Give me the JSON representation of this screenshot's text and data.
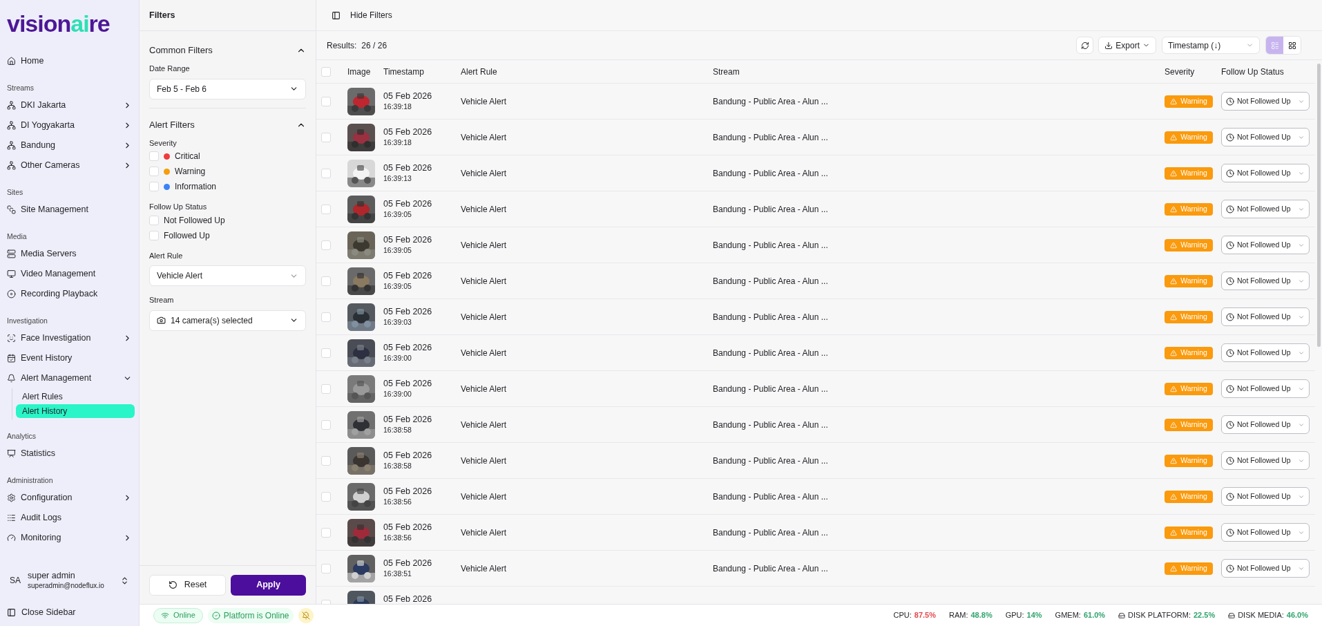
{
  "logo": {
    "parts": [
      "vision",
      "ai",
      "re"
    ]
  },
  "sidebar": {
    "sections": [
      {
        "items": [
          {
            "label": "Home",
            "selected": false
          }
        ]
      },
      {
        "title": "Streams",
        "items": [
          {
            "label": "DKI Jakarta",
            "selected": false,
            "expanded": false
          },
          {
            "label": "DI Yogyakarta",
            "selected": false,
            "expanded": false
          },
          {
            "label": "Bandung",
            "selected": false,
            "expanded": false
          },
          {
            "label": "Other Cameras",
            "selected": false,
            "expanded": false
          }
        ]
      },
      {
        "title": "Sites",
        "items": [
          {
            "label": "Site Management",
            "selected": false
          }
        ]
      },
      {
        "title": "Media",
        "items": [
          {
            "label": "Media Servers",
            "selected": false
          },
          {
            "label": "Video Management",
            "selected": false
          },
          {
            "label": "Recording Playback",
            "selected": false
          }
        ]
      },
      {
        "title": "Investigation",
        "items": [
          {
            "label": "Face Investigation",
            "selected": false,
            "expanded": false
          },
          {
            "label": "Event History",
            "selected": false
          },
          {
            "label": "Alert Management",
            "selected": false,
            "expanded": true,
            "children": [
              {
                "label": "Alert Rules",
                "selected": false
              },
              {
                "label": "Alert History",
                "selected": true
              }
            ]
          }
        ]
      },
      {
        "title": "Analytics",
        "items": [
          {
            "label": "Statistics",
            "selected": false
          }
        ]
      },
      {
        "title": "Administration",
        "items": [
          {
            "label": "Configuration",
            "selected": false,
            "expanded": false
          },
          {
            "label": "Audit Logs",
            "selected": false
          },
          {
            "label": "Monitoring",
            "selected": false,
            "expanded": false
          }
        ]
      }
    ],
    "user": {
      "initials": "SA",
      "name": "super admin",
      "email": "superadmin@nodeflux.io"
    },
    "close_label": "Close Sidebar"
  },
  "filters": {
    "title": "Filters",
    "common": {
      "title": "Common Filters",
      "expanded": true,
      "date_label": "Date Range",
      "date_value": "Feb 5 - Feb 6"
    },
    "alert": {
      "title": "Alert Filters",
      "expanded": true,
      "severity_label": "Severity",
      "severities": [
        {
          "label": "Critical",
          "checked": false,
          "color": "#ef3b3b"
        },
        {
          "label": "Warning",
          "checked": false,
          "color": "#f59e0b"
        },
        {
          "label": "Information",
          "checked": false,
          "color": "#3b82f6"
        }
      ],
      "follow_label": "Follow Up Status",
      "follow": [
        {
          "label": "Not Followed Up",
          "checked": false
        },
        {
          "label": "Followed Up",
          "checked": false
        }
      ],
      "rule_label": "Alert Rule",
      "rule_value": "Vehicle Alert",
      "stream_label": "Stream",
      "stream_value": "14 camera(s) selected"
    },
    "reset": "Reset",
    "apply": "Apply"
  },
  "main": {
    "hide_filters": "Hide Filters",
    "results_label": "Results:",
    "results_count": "26 / 26",
    "export": "Export",
    "sort": "Timestamp (↓)",
    "views": [
      {
        "kind": "list",
        "selected": true
      },
      {
        "kind": "grid",
        "selected": false
      }
    ],
    "select_all": {
      "checked": false
    },
    "table": {
      "columns": [
        "Image",
        "Timestamp",
        "Alert Rule",
        "Stream",
        "Severity",
        "Follow Up Status"
      ],
      "rows": [
        {
          "checked": false,
          "date": "05 Feb 2026",
          "time": "16:39:18",
          "rule": "Vehicle Alert",
          "stream": "Bandung - Public Area - Alun ...",
          "severity": "Warning",
          "status": "Not Followed Up"
        },
        {
          "checked": false,
          "date": "05 Feb 2026",
          "time": "16:39:18",
          "rule": "Vehicle Alert",
          "stream": "Bandung - Public Area - Alun ...",
          "severity": "Warning",
          "status": "Not Followed Up"
        },
        {
          "checked": false,
          "date": "05 Feb 2026",
          "time": "16:39:13",
          "rule": "Vehicle Alert",
          "stream": "Bandung - Public Area - Alun ...",
          "severity": "Warning",
          "status": "Not Followed Up"
        },
        {
          "checked": false,
          "date": "05 Feb 2026",
          "time": "16:39:05",
          "rule": "Vehicle Alert",
          "stream": "Bandung - Public Area - Alun ...",
          "severity": "Warning",
          "status": "Not Followed Up"
        },
        {
          "checked": false,
          "date": "05 Feb 2026",
          "time": "16:39:05",
          "rule": "Vehicle Alert",
          "stream": "Bandung - Public Area - Alun ...",
          "severity": "Warning",
          "status": "Not Followed Up"
        },
        {
          "checked": false,
          "date": "05 Feb 2026",
          "time": "16:39:05",
          "rule": "Vehicle Alert",
          "stream": "Bandung - Public Area - Alun ...",
          "severity": "Warning",
          "status": "Not Followed Up"
        },
        {
          "checked": false,
          "date": "05 Feb 2026",
          "time": "16:39:03",
          "rule": "Vehicle Alert",
          "stream": "Bandung - Public Area - Alun ...",
          "severity": "Warning",
          "status": "Not Followed Up"
        },
        {
          "checked": false,
          "date": "05 Feb 2026",
          "time": "16:39:00",
          "rule": "Vehicle Alert",
          "stream": "Bandung - Public Area - Alun ...",
          "severity": "Warning",
          "status": "Not Followed Up"
        },
        {
          "checked": false,
          "date": "05 Feb 2026",
          "time": "16:39:00",
          "rule": "Vehicle Alert",
          "stream": "Bandung - Public Area - Alun ...",
          "severity": "Warning",
          "status": "Not Followed Up"
        },
        {
          "checked": false,
          "date": "05 Feb 2026",
          "time": "16:38:58",
          "rule": "Vehicle Alert",
          "stream": "Bandung - Public Area - Alun ...",
          "severity": "Warning",
          "status": "Not Followed Up"
        },
        {
          "checked": false,
          "date": "05 Feb 2026",
          "time": "16:38:58",
          "rule": "Vehicle Alert",
          "stream": "Bandung - Public Area - Alun ...",
          "severity": "Warning",
          "status": "Not Followed Up"
        },
        {
          "checked": false,
          "date": "05 Feb 2026",
          "time": "16:38:56",
          "rule": "Vehicle Alert",
          "stream": "Bandung - Public Area - Alun ...",
          "severity": "Warning",
          "status": "Not Followed Up"
        },
        {
          "checked": false,
          "date": "05 Feb 2026",
          "time": "16:38:56",
          "rule": "Vehicle Alert",
          "stream": "Bandung - Public Area - Alun ...",
          "severity": "Warning",
          "status": "Not Followed Up"
        },
        {
          "checked": false,
          "date": "05 Feb 2026",
          "time": "16:38:51",
          "rule": "Vehicle Alert",
          "stream": "Bandung - Public Area - Alun ...",
          "severity": "Warning",
          "status": "Not Followed Up"
        },
        {
          "checked": false,
          "date": "05 Feb 2026"
        }
      ]
    }
  },
  "status_bar": {
    "online": "Online",
    "platform": "Platform is Online",
    "metrics": [
      {
        "label": "CPU:",
        "value": "87.5%",
        "color": "#e5484d"
      },
      {
        "label": "RAM:",
        "value": "48.8%",
        "color": "#30a46c"
      },
      {
        "label": "GPU:",
        "value": "14%",
        "color": "#30a46c"
      },
      {
        "label": "GMEM:",
        "value": "61.0%",
        "color": "#30a46c"
      },
      {
        "label": "DISK PLATFORM:",
        "value": "22.5%",
        "color": "#30a46c",
        "kind": "disk"
      },
      {
        "label": "DISK MEDIA:",
        "value": "46.0%",
        "color": "#30a46c",
        "kind": "disk"
      }
    ]
  }
}
